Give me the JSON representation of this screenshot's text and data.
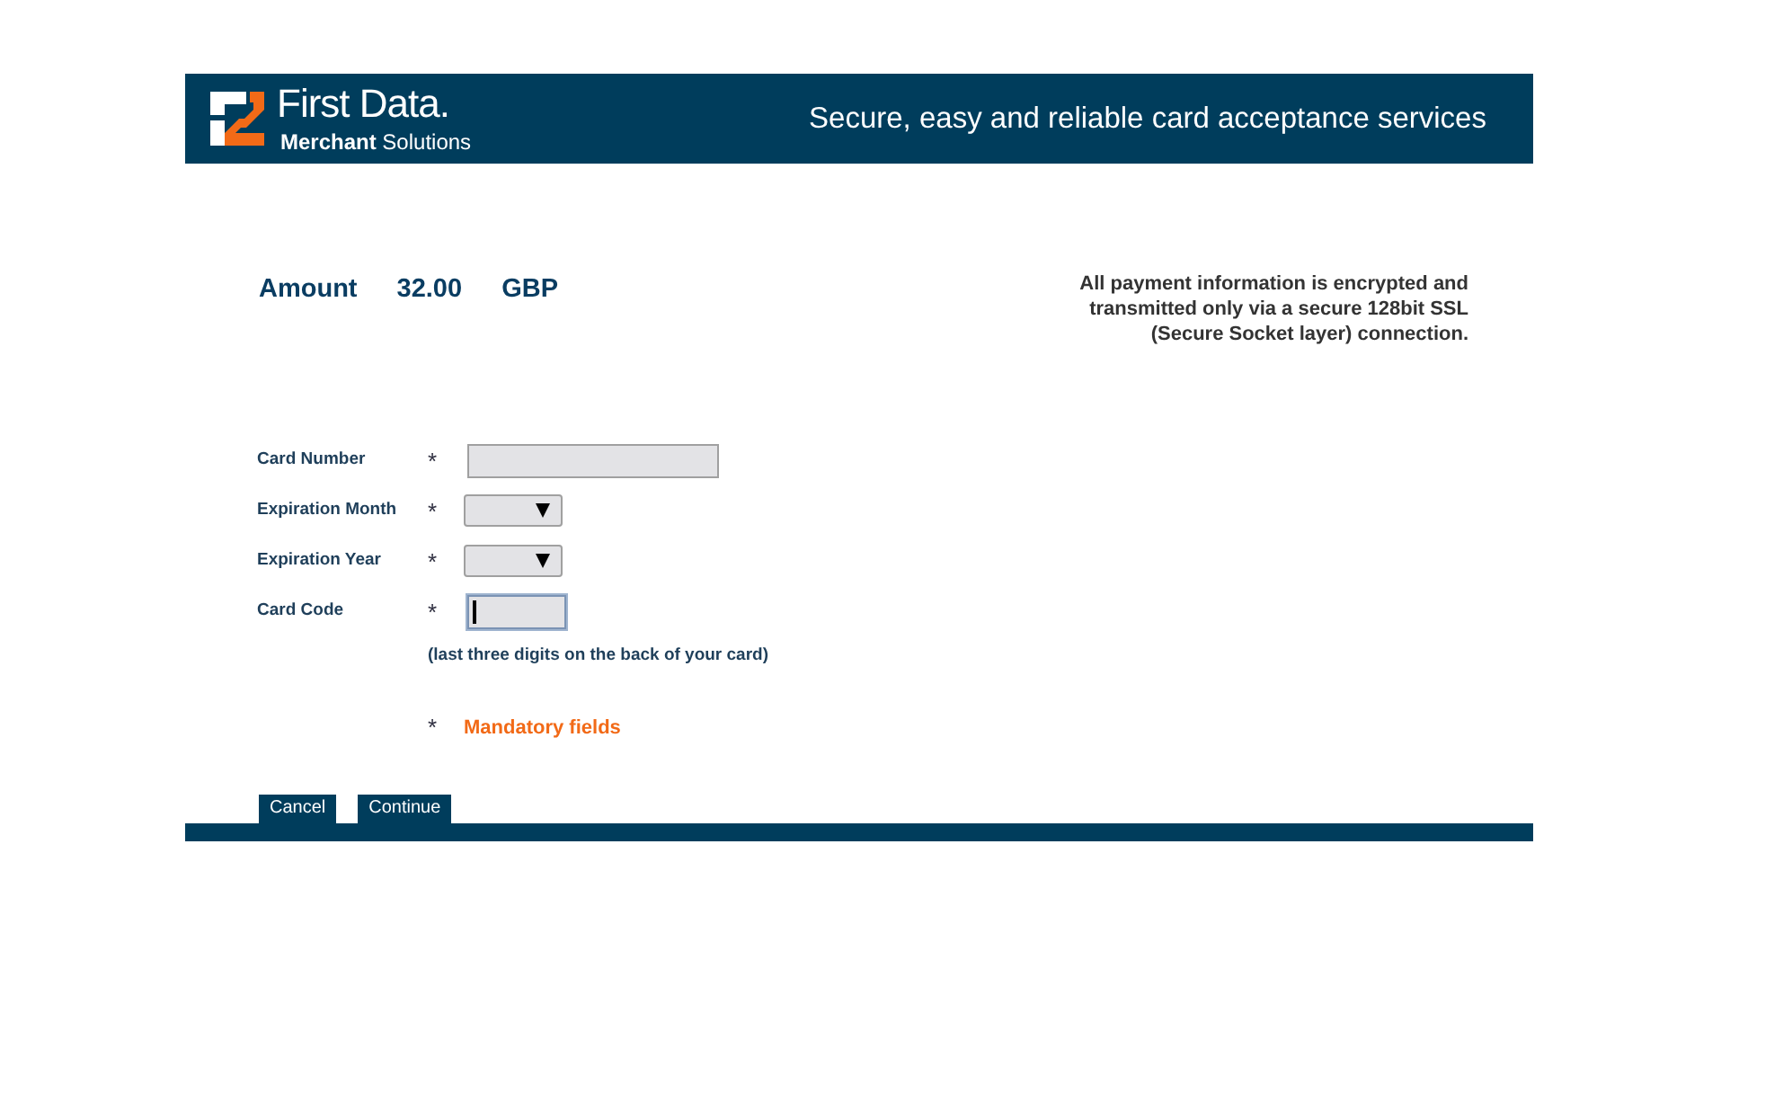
{
  "header": {
    "brand": "First Data.",
    "brand_sub": "**Merchant** Solutions",
    "tagline": "Secure, easy and reliable card acceptance services"
  },
  "amount": {
    "label": "Amount",
    "value": "32.00",
    "currency": "GBP"
  },
  "security_note": "All payment information is encrypted and transmitted only via a secure 128bit SSL (Secure Socket layer) connection.",
  "fields": [
    {
      "label": "Card Number",
      "marker": "*",
      "kind": "text",
      "focused": false
    },
    {
      "label": "Expiration Month",
      "marker": "*",
      "kind": "select",
      "focused": false
    },
    {
      "label": "Expiration Year",
      "marker": "*",
      "kind": "select",
      "focused": false
    },
    {
      "label": "Card Code",
      "marker": "*",
      "kind": "code",
      "focused": true
    }
  ],
  "hint_link": "(last three digits on the back of your card)",
  "mandatory": {
    "marker": "*",
    "text": "Mandatory fields"
  },
  "buttons": [
    "Cancel",
    "Continue"
  ]
}
